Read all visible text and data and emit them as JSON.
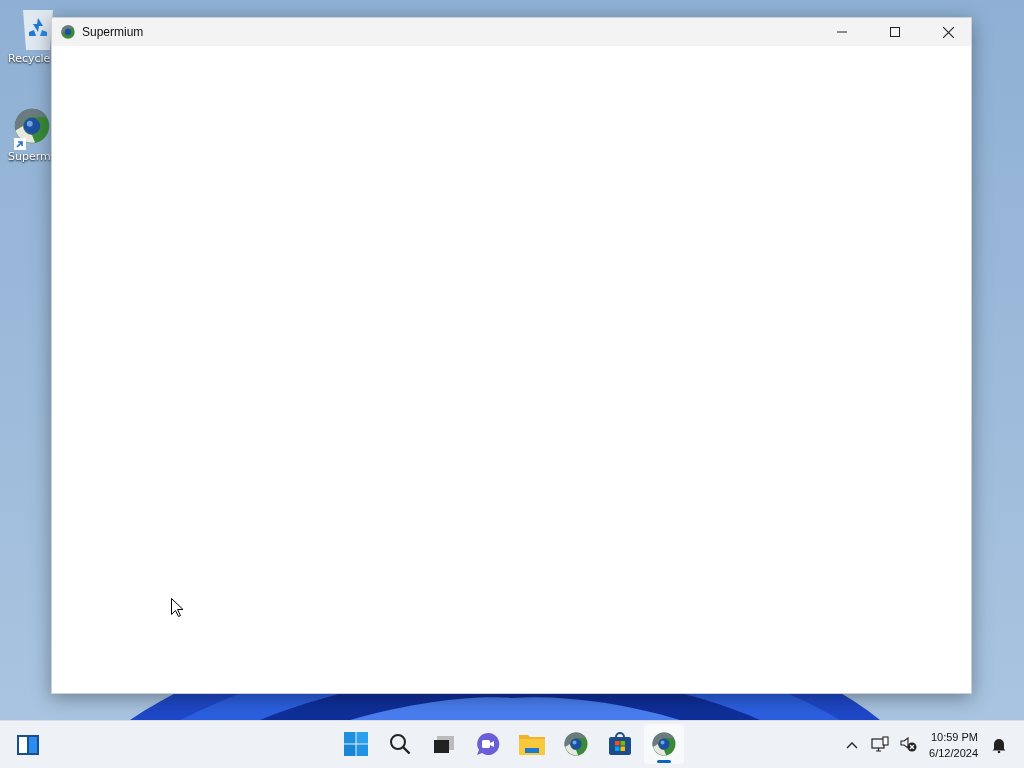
{
  "desktop_icons": [
    {
      "kind": "recycle",
      "label": "Recycle"
    },
    {
      "kind": "supermium",
      "label": "Superm",
      "shortcut": true
    }
  ],
  "window": {
    "title": "Supermium"
  },
  "taskbar": {
    "widgets": {
      "kind": "widgets"
    },
    "apps": [
      {
        "kind": "start",
        "active": false
      },
      {
        "kind": "search",
        "active": false
      },
      {
        "kind": "taskview",
        "active": false
      },
      {
        "kind": "chat",
        "active": false
      },
      {
        "kind": "explorer",
        "active": false
      },
      {
        "kind": "supermium",
        "active": false
      },
      {
        "kind": "store",
        "active": false
      },
      {
        "kind": "supermium",
        "active": true
      }
    ],
    "tray": [
      {
        "kind": "chevron"
      },
      {
        "kind": "network"
      },
      {
        "kind": "muted"
      }
    ],
    "time": "10:59 PM",
    "date": "6/12/2024"
  }
}
